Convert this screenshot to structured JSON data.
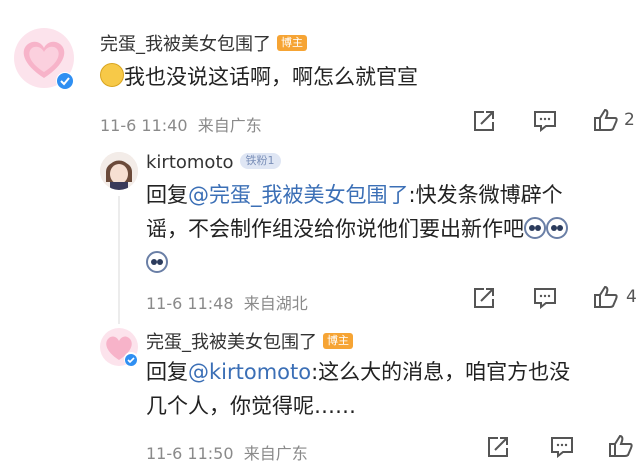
{
  "comments": [
    {
      "username": "完蛋_我被美女包围了",
      "badge": "博主",
      "text": "我也没说这话啊，啊怎么就官宣",
      "time": "11-6 11:40",
      "location": "来自广东",
      "like_count": "2"
    },
    {
      "username": "kirtomoto",
      "badge": "铁粉1",
      "reply_prefix": "回复",
      "mention": "@完蛋_我被美女包围了",
      "text_line1": ":快发条微博辟个",
      "text_line2": "谣，不会制作组没给你说他们要出新作吧",
      "time": "11-6 11:48",
      "location": "来自湖北",
      "like_count": "4"
    },
    {
      "username": "完蛋_我被美女包围了",
      "badge": "博主",
      "reply_prefix": "回复",
      "mention": "@kirtomoto",
      "text_line1": ":这么大的消息，咱官方也没",
      "text_line2": "几个人，你觉得呢……",
      "time": "11-6 11:50",
      "location": "来自广东"
    }
  ],
  "icons": {
    "share": "share-icon",
    "comment": "comment-icon",
    "like": "like-icon",
    "verified": "verified-icon"
  },
  "colors": {
    "mention": "#3b6fb6",
    "badge_owner": "#f6a434",
    "badge_fan": "#dfe6f4",
    "avatar_pink": "#f7b3c9"
  }
}
